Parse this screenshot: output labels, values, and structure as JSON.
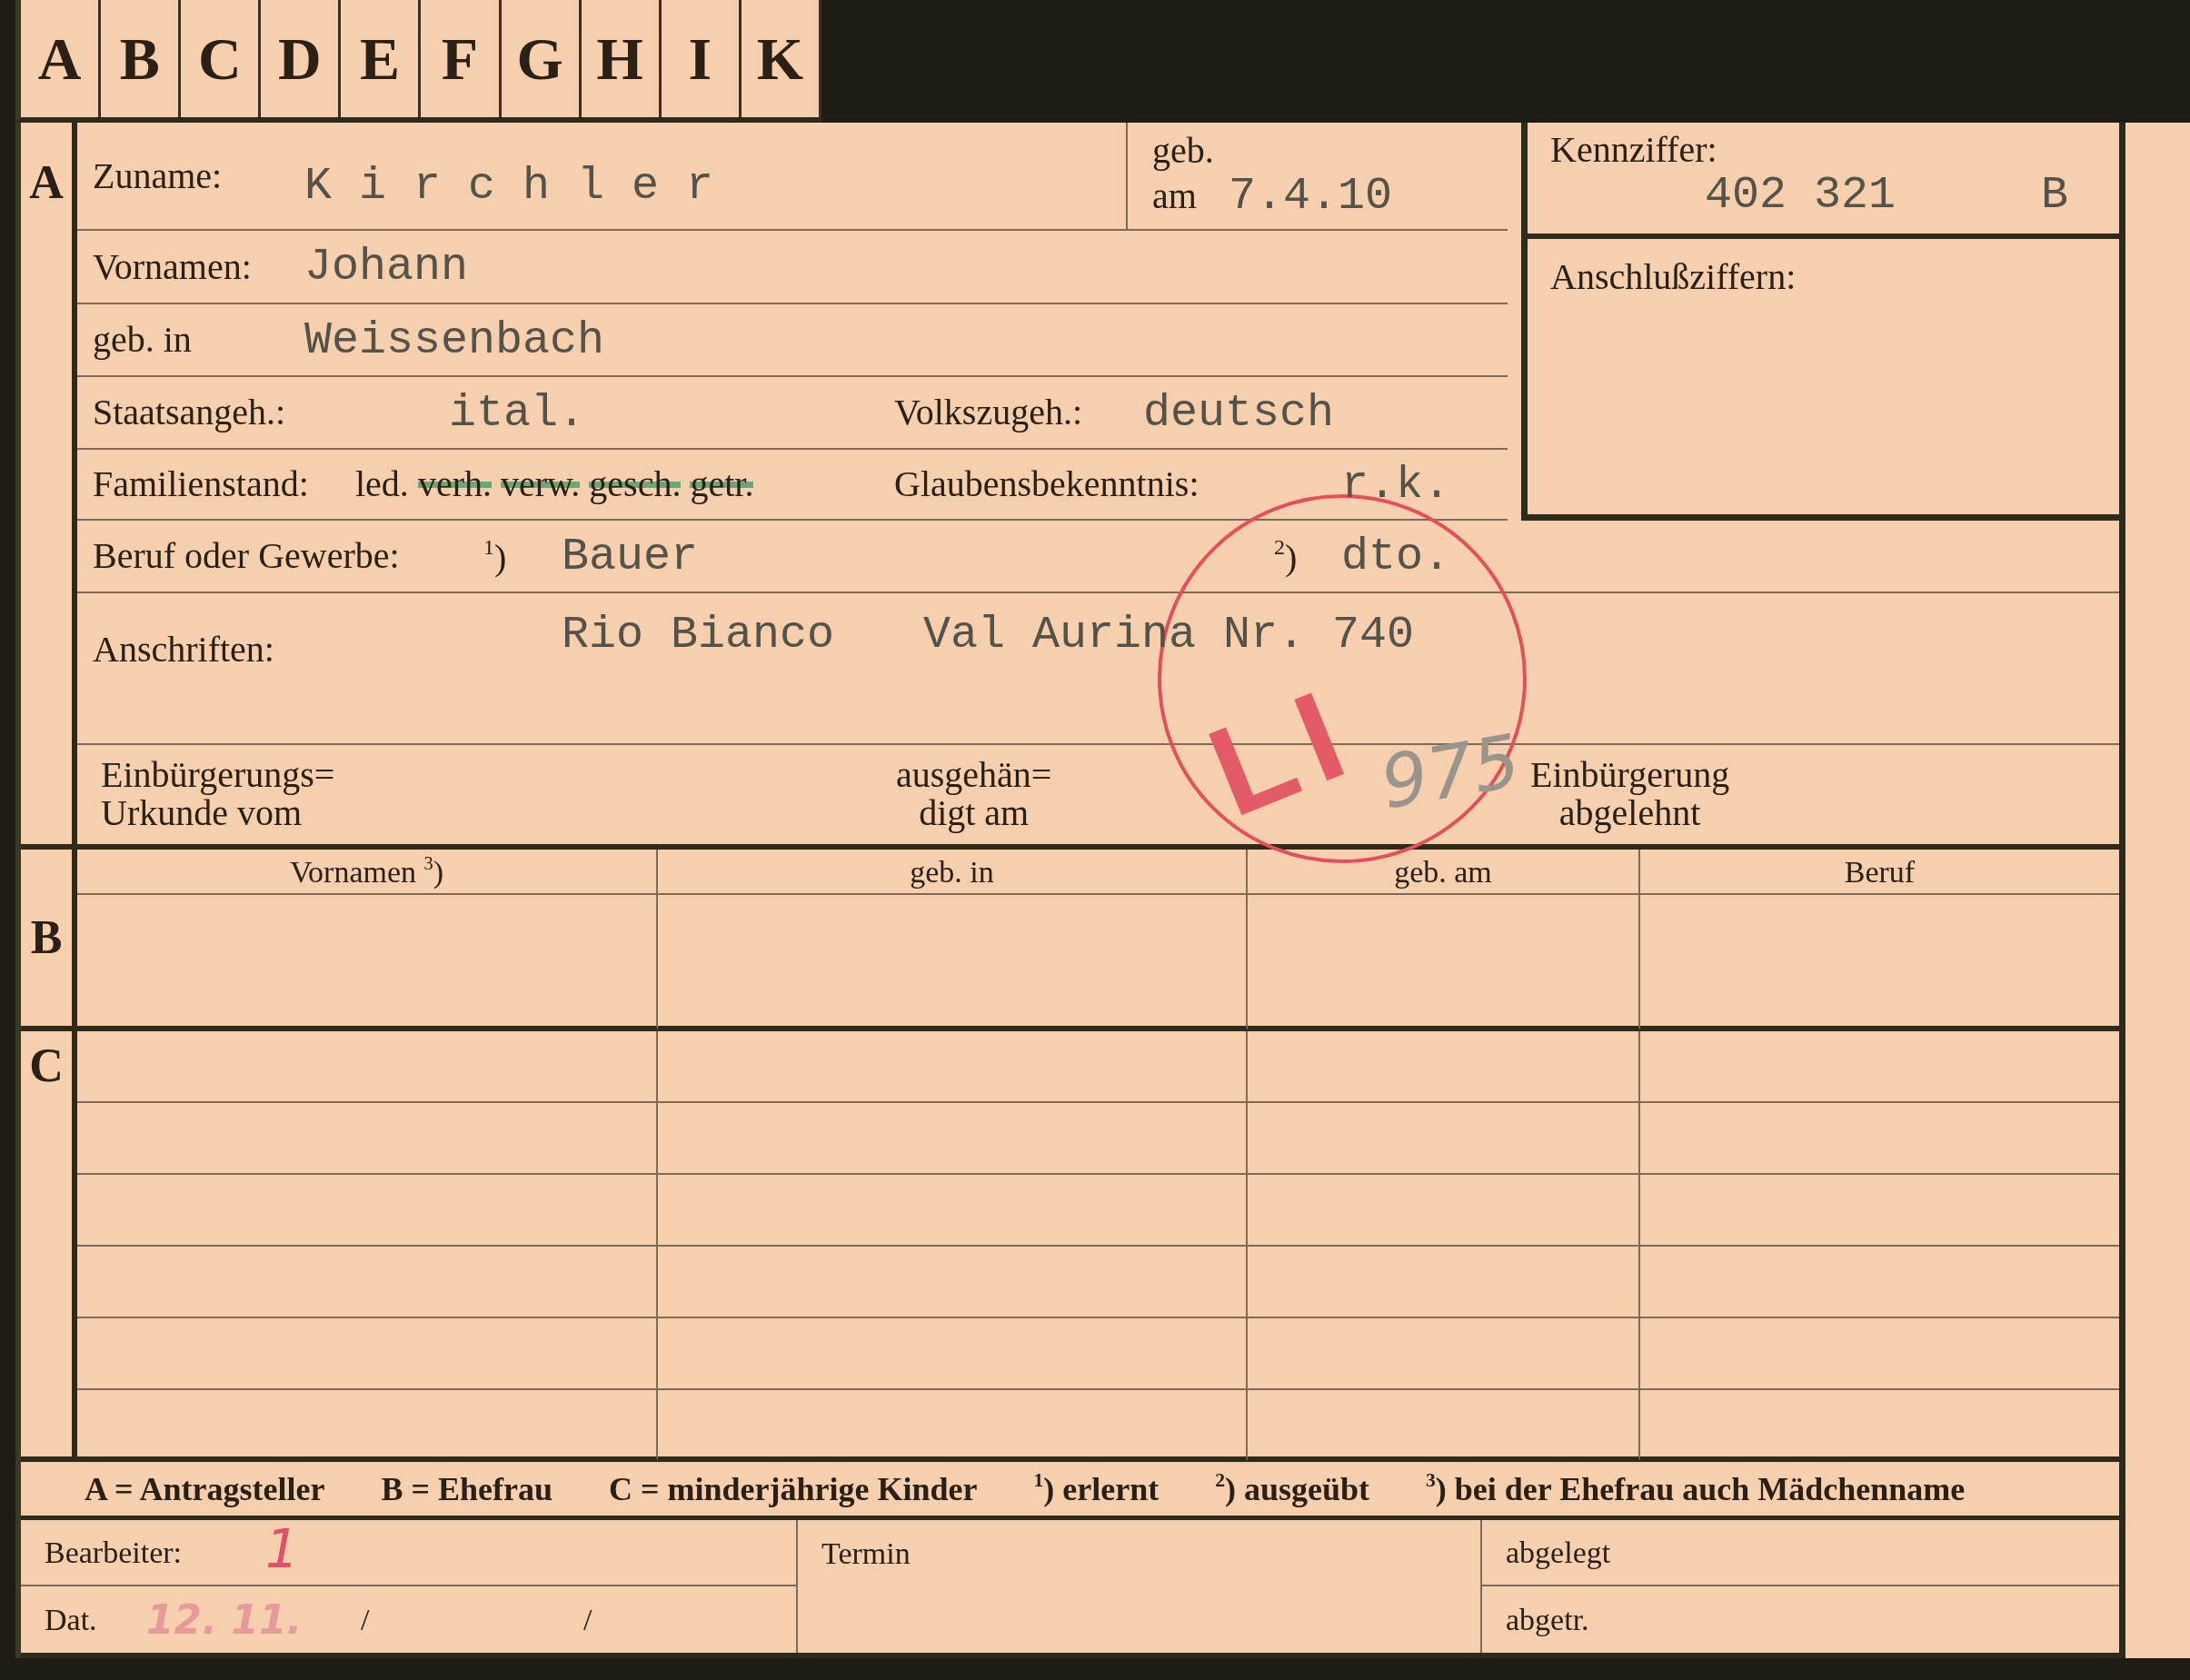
{
  "register_tabs": [
    "A",
    "B",
    "C",
    "D",
    "E",
    "F",
    "G",
    "H",
    "I",
    "K"
  ],
  "section_a": {
    "letter": "A",
    "surname": {
      "label": "Zuname:",
      "value": "K i r c h l e r"
    },
    "birth_date": {
      "label_top": "geb.",
      "label": "am",
      "value": "7.4.10"
    },
    "first_names": {
      "label": "Vornamen:",
      "value": "Johann"
    },
    "birthplace": {
      "label": "geb. in",
      "value": "Weissenbach"
    },
    "citizenship": {
      "label": "Staatsangeh.:",
      "value": "ital."
    },
    "nationality": {
      "label": "Volkszugeh.:",
      "value": "deutsch"
    },
    "marital_status": {
      "label": "Familienstand:",
      "options": [
        {
          "text": "led.",
          "struck": false
        },
        {
          "text": "verh.",
          "struck": true
        },
        {
          "text": "verw.",
          "struck": true
        },
        {
          "text": "gesch.",
          "struck": true
        },
        {
          "text": "getr.",
          "struck": true
        }
      ]
    },
    "religion": {
      "label": "Glaubensbekenntnis:",
      "value": "r.k."
    },
    "occupation": {
      "label": "Beruf oder Gewerbe:",
      "learned_note": "$^{1}$)",
      "learned": "Bauer",
      "practised_note": "$^{2}$)",
      "practised": "dto."
    },
    "addresses": {
      "label": "Anschriften:",
      "values": [
        "Rio Bianco",
        "Val Aurina Nr. 740"
      ]
    },
    "naturalization_certificate": {
      "label": [
        "Einbürgerungs=",
        "Urkunde vom"
      ]
    },
    "handed_over": {
      "label": [
        "ausgehän=",
        "digt am"
      ]
    },
    "naturalization_refused": {
      "label": [
        "Einbürgerung",
        "abgelehnt"
      ]
    },
    "reference_number": {
      "label": "Kennziffer:",
      "value": "402 321",
      "suffix": "B"
    },
    "linked_numbers": {
      "label": "Anschlußziffern:"
    }
  },
  "stamp": {
    "letters": "LI",
    "handwritten": "975"
  },
  "section_b": {
    "letter": "B",
    "columns": [
      "Vornamen $^{3}$)",
      "geb. in",
      "geb. am",
      "Beruf"
    ]
  },
  "section_c": {
    "letter": "C"
  },
  "legend": [
    "A = Antragsteller",
    "B = Ehefrau",
    "C = minderjährige Kinder",
    "$^{1}$) erlernt",
    "$^{2}$) ausgeübt",
    "$^{3}$) bei der Ehefrau auch Mädchenname"
  ],
  "footer": {
    "clerk": {
      "label": "Bearbeiter:",
      "value": "1"
    },
    "date": {
      "label": "Dat.",
      "value": "12. 11.",
      "separators": [
        "/",
        "/"
      ]
    },
    "deadline": {
      "label": "Termin"
    },
    "filed": {
      "label": "abgelegt"
    },
    "removed": {
      "label": "abgetr."
    }
  }
}
